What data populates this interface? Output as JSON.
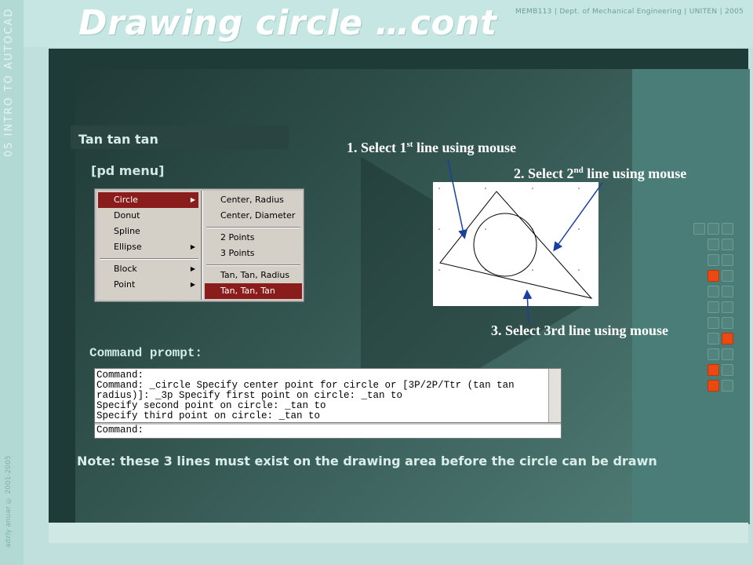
{
  "slide": {
    "title": "Drawing circle …cont",
    "course_label": "05 INTRO TO AUTOCAD",
    "source_line": "MEMB113 | Dept. of Mechanical Engineering | UNITEN | 2005",
    "copyright": "adzly anuar © 2001-2005"
  },
  "section": {
    "label": "Tan tan tan",
    "pd_menu_label": "[pd menu]"
  },
  "draw_menu": {
    "items": [
      {
        "label": "Circle",
        "submenu": true,
        "highlighted": true
      },
      {
        "label": "Donut",
        "submenu": false,
        "highlighted": false
      },
      {
        "label": "Spline",
        "submenu": false,
        "highlighted": false
      },
      {
        "label": "Ellipse",
        "submenu": true,
        "highlighted": false
      },
      {
        "label": "Block",
        "submenu": true,
        "highlighted": false
      },
      {
        "label": "Point",
        "submenu": true,
        "highlighted": false
      }
    ]
  },
  "circle_submenu": {
    "items": [
      {
        "label": "Center, Radius",
        "highlighted": false
      },
      {
        "label": "Center, Diameter",
        "highlighted": false
      },
      {
        "label": "2 Points",
        "highlighted": false
      },
      {
        "label": "3 Points",
        "highlighted": false
      },
      {
        "label": "Tan, Tan, Radius",
        "highlighted": false
      },
      {
        "label": "Tan, Tan, Tan",
        "highlighted": true
      }
    ]
  },
  "annotations": {
    "step1": {
      "prefix": "1. Select 1",
      "sup": "st",
      "suffix": " line using mouse"
    },
    "step2": {
      "prefix": "2. Select 2",
      "sup": "nd",
      "suffix": " line using mouse"
    },
    "step3": "3. Select 3rd line using mouse"
  },
  "command": {
    "heading": "Command prompt:",
    "history": [
      "Command:",
      "Command: _circle Specify center point for circle or [3P/2P/Ttr (tan tan",
      "radius)]: _3p Specify first point on circle: _tan to",
      "Specify second point on circle: _tan to",
      "Specify third point on circle: _tan to"
    ],
    "input_line": "Command:"
  },
  "note": "Note: these 3 lines must exist on the drawing area before the circle can be drawn",
  "colors": {
    "accent_orange": "#ea4a12",
    "menu_highlight": "#8b1c1c",
    "panel_dark": "#203a37",
    "background_teal": "#bfe0dc"
  }
}
